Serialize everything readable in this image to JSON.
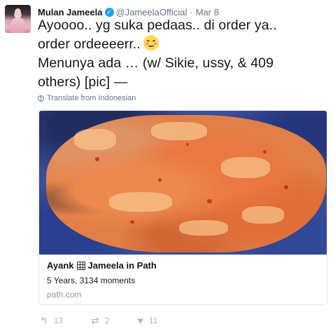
{
  "tweet": {
    "author_name": "Mulan Jameela",
    "handle": "@JameelaOfficial",
    "separator": "·",
    "date": "Mar 8",
    "text_line1": "Ayoooo.. yg suka pedaas.. di order ya..",
    "text_line2": "order ordeeeerr..",
    "text_line3": "Menunya ada … (w/ Sikie, ussy, & 409",
    "text_line4": "others) [pic] —",
    "emoji": "relieved-face-emoji",
    "translate_label": "Translate from Indonesian"
  },
  "card": {
    "title_part1": "Ayank",
    "title_part2": "Jameela in Path",
    "description": "5 Years, 3134 moments",
    "domain": "path.com",
    "image": "photo of spicy fried food on a blue plate"
  },
  "actions": {
    "reply_count": "13",
    "retweet_count": "2",
    "like_count": "11"
  },
  "icons": {
    "verified": "verified-badge-icon",
    "globe": "globe-icon",
    "reply": "reply-icon",
    "retweet": "retweet-icon",
    "like": "heart-icon"
  },
  "colors": {
    "verified": "#1da1f2",
    "secondary_text": "#657786",
    "action_icons": "#aab8c2"
  }
}
